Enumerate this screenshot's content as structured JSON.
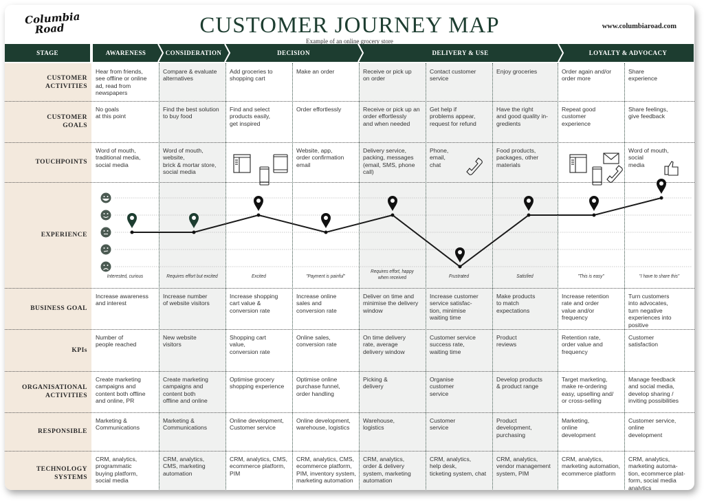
{
  "header": {
    "logo": "Columbia Road",
    "title": "CUSTOMER JOURNEY MAP",
    "subtitle": "Example of an online grocery store",
    "website": "www.columbiaroad.com"
  },
  "colors": {
    "dark_green": "#1d3d30",
    "label_bg": "#f3e9dd",
    "shade_bg": "#f0f1f0",
    "smiley": "#4b5a52",
    "line": "#1a1a1a"
  },
  "stages": [
    {
      "label": "STAGE"
    },
    {
      "label": "AWARENESS"
    },
    {
      "label": "CONSIDERATION"
    },
    {
      "label": "DECISION"
    },
    {
      "label": "DELIVERY & USE"
    },
    {
      "label": "LOYALTY  & ADVOCACY"
    }
  ],
  "rows": [
    {
      "label": "CUSTOMER\nACTIVITIES",
      "cells": [
        "Hear from friends,\nsee offline or online\nad, read from\nnewspapers",
        "Compare & evaluate\nalternatives",
        "Add groceries to\nshopping cart",
        "Make an order",
        "Receive or pick up\non order",
        "Contact customer\nservice",
        "Enjoy groceries",
        "Order again and/or\norder more",
        "Share\nexperience"
      ]
    },
    {
      "label": "CUSTOMER\nGOALS",
      "cells": [
        "No goals\nat this point",
        "Find the best solution\nto buy food",
        "Find and select\nproducts easily,\nget inspired",
        "Order effortlessly",
        "Receive or pick up an\norder effortlessly\nand when needed",
        "Get help if\nproblems appear,\nrequest for refund",
        "Have the right\nand good quality in-\ngredients",
        "Repeat good\ncustomer\nexperience",
        "Share feelings,\ngive feedback"
      ]
    },
    {
      "label": "TOUCHPOINTS",
      "cells": [
        "Word of mouth,\ntraditional media,\nsocial media",
        "Word of mouth,\nwebsite,\nbrick & mortar store,\nsocial media",
        "",
        "Website, app,\norder confirmation\nemail",
        "Delivery service,\npacking, messages\n(email, SMS, phone\ncall)",
        "Phone,\nemail,\nchat",
        "Food products,\npackages, other\nmaterials",
        "",
        "Word of mouth,\nsocial\nmedia"
      ],
      "icons": [
        [],
        [],
        [
          "browser-icon",
          "smartphone-icon",
          "tablet-icon"
        ],
        [],
        [],
        [
          "phone-handset-icon"
        ],
        [],
        [
          "browser-icon",
          "smartphone-icon",
          "envelope-icon",
          "phone-handset-icon"
        ],
        [
          "thumbs-up-icon"
        ]
      ]
    },
    {
      "label": "EXPERIENCE",
      "experience": {
        "scale_levels": [
          "very-happy",
          "happy",
          "neutral",
          "unhappy",
          "sad"
        ],
        "scale_icons": [
          "very-happy-face-icon",
          "happy-face-icon",
          "neutral-face-icon",
          "unhappy-face-icon",
          "sad-face-icon"
        ],
        "values": [
          3,
          3,
          4,
          3,
          4,
          1,
          4,
          4,
          5
        ],
        "value_scale": "1 = sad, 5 = very happy",
        "labels": [
          "Interested, curious",
          "Requires effort but excited",
          "Excited",
          "\"Payment is painful\"",
          "Requires effort, happy\nwhen received",
          "Frustrated",
          "Satisfied",
          "\"This is easy\"",
          "\"I have to share this\""
        ],
        "pin_colors": [
          "#1d3d30",
          "#1d3d30",
          "#111111",
          "#111111",
          "#111111",
          "#111111",
          "#111111",
          "#111111",
          "#111111"
        ]
      }
    },
    {
      "label": "BUSINESS GOAL",
      "cells": [
        "Increase awareness\nand interest",
        "Increase number\nof website visitors",
        "Increase shopping\ncart value &\nconversion rate",
        "Increase online\nsales and\nconversion rate",
        "Deliver on time and\nminimise the delivery\nwindow",
        "Increase customer\nservice satisfac-\ntion, minimise\nwaiting time",
        "Make products\nto match\nexpectations",
        "Increase retention\nrate and order\nvalue and/or\nfrequency",
        "Turn customers\ninto advocates,\nturn negative\nexperiences into\npositive"
      ]
    },
    {
      "label": "KPIs",
      "cells": [
        "Number of\npeople reached",
        "New website\nvisitors",
        "Shopping cart\nvalue,\nconversion rate",
        "Online sales,\nconversion rate",
        "On time delivery\nrate, average\ndelivery window",
        "Customer service\nsuccess rate,\nwaiting time",
        "Product\nreviews",
        "Retention rate,\norder value and\nfrequency",
        "Customer\nsatisfaction"
      ]
    },
    {
      "label": "ORGANISATIONAL\nACTIVITIES",
      "cells": [
        "Create marketing\ncampaigns and\ncontent both offline\nand online, PR",
        "Create marketing\ncampaigns and\ncontent both\noffline and online",
        "Optimise grocery\nshopping experience",
        "Optimise online\npurchase funnel,\norder handling",
        "Picking &\ndelivery",
        "Organise\ncustomer\nservice",
        "Develop products\n& product range",
        "Target marketing,\nmake re-ordering\neasy, upselling and/\nor cross-selling",
        "Manage feedback\nand social media,\ndevelop sharing /\ninviting possibilities"
      ]
    },
    {
      "label": "RESPONSIBLE",
      "cells": [
        "Marketing &\nCommunications",
        "Marketing &\nCommunications",
        "Online development,\nCustomer service",
        "Online development,\nwarehouse, logistics",
        "Warehouse,\nlogistics",
        "Customer\nservice",
        "Product\ndevelopment,\npurchasing",
        "Marketing,\nonline\ndevelopment",
        "Customer service,\nonline\ndevelopment"
      ]
    },
    {
      "label": "TECHNOLOGY\nSYSTEMS",
      "cells": [
        "CRM, analytics,\nprogrammatic\nbuying platform,\nsocial media",
        "CRM, analytics,\nCMS, marketing\nautomation",
        "CRM, analytics, CMS,\necommerce platform,\nPIM",
        "CRM, analytics, CMS,\necommerce platform,\nPIM, inventory system,\nmarketing automation",
        "CRM, analytics,\norder & delivery\nsystem, marketing\nautomation",
        "CRM, analytics,\nhelp desk,\nticketing system, chat",
        "CRM, analytics,\nvendor management\nsystem, PIM",
        "CRM, analytics,\nmarketing automation,\necommerce platform",
        "CRM, analytics,\nmarketing automa-\ntion, ecommerce plat-\nform, social media\nanalytics"
      ]
    }
  ]
}
